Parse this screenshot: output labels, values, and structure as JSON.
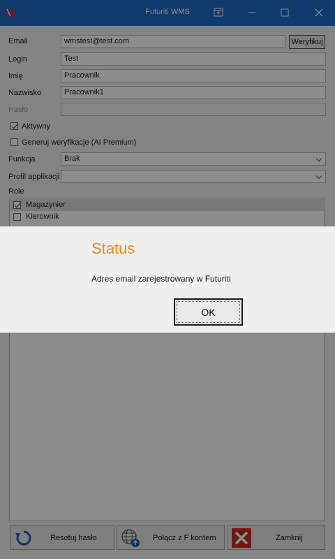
{
  "window": {
    "title": "Futuriti WMS"
  },
  "form": {
    "email_label": "Email",
    "email_value": "wmstest@test.com",
    "verify_button": "Weryfikuj",
    "login_label": "Login",
    "login_value": "Test",
    "first_name_label": "Imię",
    "first_name_value": "Pracownik",
    "last_name_label": "Nazwisko",
    "last_name_value": "Pracownik1",
    "password_label": "Hasło",
    "password_value": "",
    "active_label": "Aktywny",
    "active_checked": true,
    "generate_verification_label": "Generuj weryfikacje (AI Premium)",
    "generate_verification_checked": false,
    "function_label": "Funkcja",
    "function_value": "Brak",
    "app_profile_label": "Profil applikacji",
    "app_profile_value": "",
    "roles_label": "Role",
    "roles": [
      {
        "label": "Magazynier",
        "checked": true
      },
      {
        "label": "Kierownik",
        "checked": false
      }
    ]
  },
  "buttons": {
    "reset_password": "Resetuj hasło",
    "connect_account": "Połącz z F kontem",
    "close": "Zamknij"
  },
  "icons": {
    "reset": "refresh-icon",
    "connect": "globe-icon",
    "close": "close-x-icon"
  },
  "dialog": {
    "title": "Status",
    "message": "Adres email zarejestrowany w Futuriti",
    "ok_button": "OK"
  },
  "colors": {
    "titlebar": "#1e6bc4",
    "dialog_title": "#f18a19",
    "close_icon_bg": "#cc2a2a",
    "logo_red": "#d9261c"
  }
}
